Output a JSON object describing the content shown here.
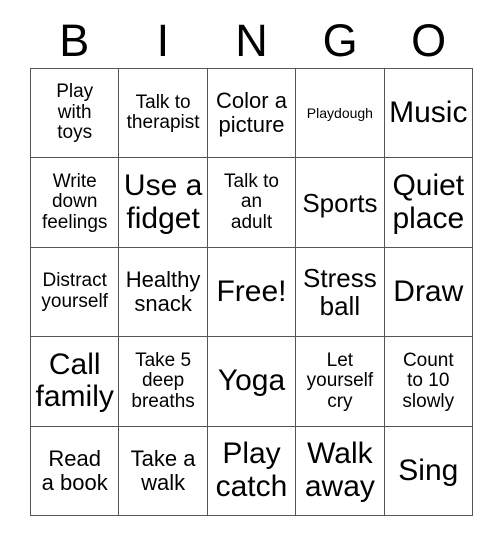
{
  "header": {
    "letters": [
      "B",
      "I",
      "N",
      "G",
      "O"
    ]
  },
  "grid": {
    "columns": 5,
    "rows": 5,
    "cells": [
      {
        "text": "Play\nwith\ntoys",
        "size": "small"
      },
      {
        "text": "Talk to\ntherapist",
        "size": "small"
      },
      {
        "text": "Color a\npicture",
        "size": "med"
      },
      {
        "text": "Playdough",
        "size": "xsmall"
      },
      {
        "text": "Music",
        "size": "xlarge"
      },
      {
        "text": "Write\ndown\nfeelings",
        "size": "small"
      },
      {
        "text": "Use a\nfidget",
        "size": "xlarge"
      },
      {
        "text": "Talk to\nan\nadult",
        "size": "small"
      },
      {
        "text": "Sports",
        "size": "large"
      },
      {
        "text": "Quiet\nplace",
        "size": "xlarge"
      },
      {
        "text": "Distract\nyourself",
        "size": "small"
      },
      {
        "text": "Healthy\nsnack",
        "size": "med"
      },
      {
        "text": "Free!",
        "size": "xlarge"
      },
      {
        "text": "Stress\nball",
        "size": "large"
      },
      {
        "text": "Draw",
        "size": "xlarge"
      },
      {
        "text": "Call\nfamily",
        "size": "xlarge"
      },
      {
        "text": "Take 5\ndeep\nbreaths",
        "size": "small"
      },
      {
        "text": "Yoga",
        "size": "xlarge"
      },
      {
        "text": "Let\nyourself\ncry",
        "size": "small"
      },
      {
        "text": "Count\nto 10\nslowly",
        "size": "small"
      },
      {
        "text": "Read\na book",
        "size": "med"
      },
      {
        "text": "Take a\nwalk",
        "size": "med"
      },
      {
        "text": "Play\ncatch",
        "size": "xlarge"
      },
      {
        "text": "Walk\naway",
        "size": "xlarge"
      },
      {
        "text": "Sing",
        "size": "xlarge"
      }
    ]
  },
  "colors": {
    "background": "#ffffff",
    "text": "#000000",
    "border": "#555555"
  }
}
